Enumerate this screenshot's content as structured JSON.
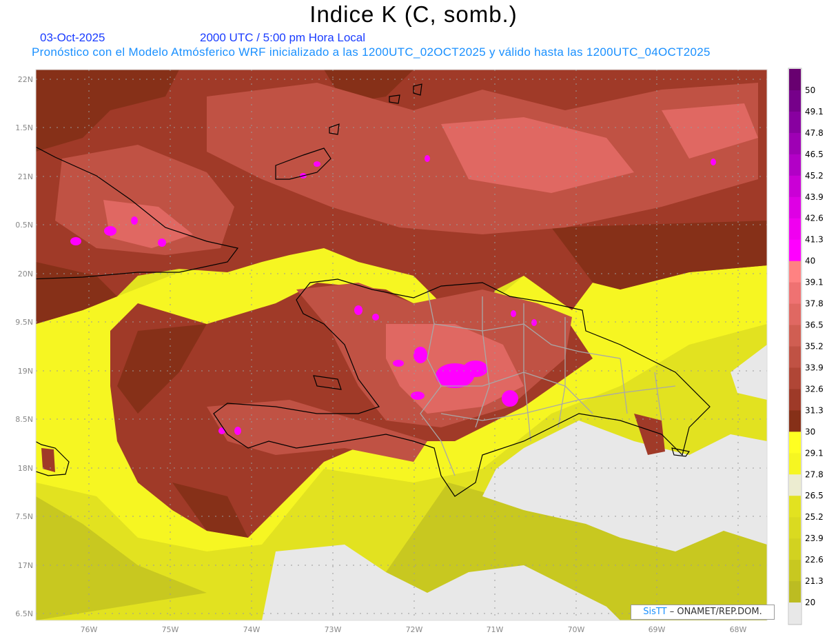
{
  "header": {
    "title": "Indice K (C, somb.)",
    "date": "03-Oct-2025",
    "time": "2000 UTC / 5:00 pm Hora Local",
    "description": "Pronóstico con el Modelo Atmósferico WRF inicializado a las 1200UTC_02OCT2025 y válido hasta las  1200UTC_04OCT2025"
  },
  "map": {
    "lon_labels": [
      "76W",
      "75W",
      "74W",
      "73W",
      "72W",
      "71W",
      "70W",
      "69W",
      "68W"
    ],
    "lat_labels": [
      "22N",
      "1.5N",
      "21N",
      "0.5N",
      "20N",
      "9.5N",
      "19N",
      "8.5N",
      "18N",
      "7.5N",
      "17N",
      "6.5N"
    ],
    "variable": "K index",
    "units": "C"
  },
  "colorbar": {
    "labels": [
      "50",
      "49.1",
      "47.8",
      "46.5",
      "45.2",
      "43.9",
      "42.6",
      "41.3",
      "40",
      "39.1",
      "37.8",
      "36.5",
      "35.2",
      "33.9",
      "32.6",
      "31.3",
      "30",
      "29.1",
      "27.8",
      "26.5",
      "25.2",
      "23.9",
      "22.6",
      "21.3",
      "20"
    ],
    "colors": [
      "#680070",
      "#76008a",
      "#8800a0",
      "#9e00b4",
      "#b200c6",
      "#ca00d6",
      "#de00e4",
      "#f000f0",
      "#ff00ff",
      "#ff8282",
      "#ef7272",
      "#e06862",
      "#d05e52",
      "#c05244",
      "#b04636",
      "#9e3a28",
      "#863018",
      "#ffff22",
      "#f6f622",
      "#ececd0",
      "#e2e220",
      "#dada20",
      "#d2d220",
      "#c8c820",
      "#bcbc22",
      "#e8e8e8"
    ]
  },
  "credit": {
    "brand": "SisTT",
    "text": "– ONAMET/REP.DOM."
  }
}
